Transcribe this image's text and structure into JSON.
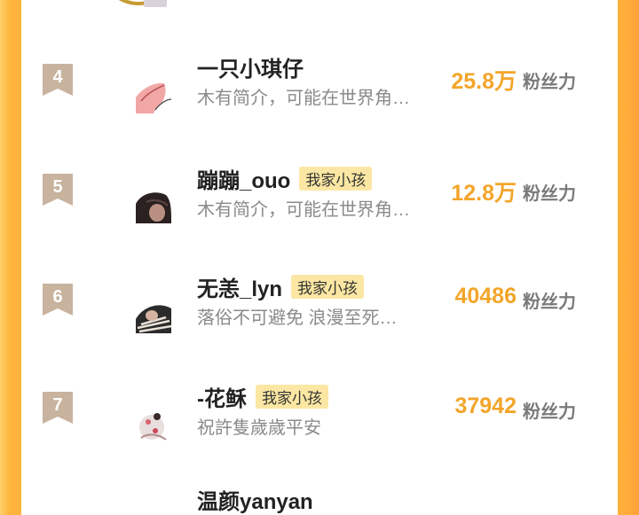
{
  "ranking": {
    "items": [
      {
        "rank": "4",
        "name": "一只小琪仔",
        "tag": "",
        "desc": "木有简介，可能在世界角…",
        "score": "25.8万",
        "unit": "粉丝力",
        "avatar_icon": "pink-drawing-avatar"
      },
      {
        "rank": "5",
        "name": "蹦蹦_ouo",
        "tag": "我家小孩",
        "desc": "木有简介，可能在世界角…",
        "score": "12.8万",
        "unit": "粉丝力",
        "avatar_icon": "dark-hair-avatar"
      },
      {
        "rank": "6",
        "name": "无恙_lyn",
        "tag": "我家小孩",
        "desc": "落俗不可避免 浪漫至死…",
        "score": "40486",
        "unit": "粉丝力",
        "avatar_icon": "striped-avatar"
      },
      {
        "rank": "7",
        "name": "-花稣",
        "tag": "我家小孩",
        "desc": "祝許隻歲歲平安",
        "score": "37942",
        "unit": "粉丝力",
        "avatar_icon": "cat-photo-avatar"
      }
    ],
    "next_partial_name": "温颜yanyan"
  },
  "colors": {
    "accent": "#f3a52a",
    "badge": "#c8b39e",
    "tag_bg": "#fbe7a3",
    "side": "#ffb33a"
  }
}
